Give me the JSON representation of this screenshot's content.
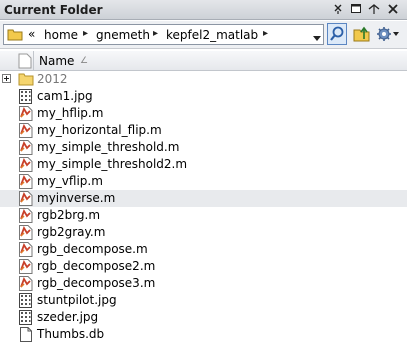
{
  "panel": {
    "title": "Current Folder"
  },
  "titlebar_buttons": [
    {
      "name": "pin-icon"
    },
    {
      "name": "undock-icon"
    },
    {
      "name": "maximize-icon"
    },
    {
      "name": "close-icon"
    }
  ],
  "address": {
    "overflow": "«",
    "crumbs": [
      "home",
      "gnemeth",
      "kepfel2_matlab"
    ],
    "separator": "▸"
  },
  "columns": {
    "name": "Name",
    "sort_indicator": "∠"
  },
  "files": [
    {
      "name": "2012",
      "type": "folder"
    },
    {
      "name": "cam1.jpg",
      "type": "image"
    },
    {
      "name": "my_hflip.m",
      "type": "mfile"
    },
    {
      "name": "my_horizontal_flip.m",
      "type": "mfile"
    },
    {
      "name": "my_simple_threshold.m",
      "type": "mfile"
    },
    {
      "name": "my_simple_threshold2.m",
      "type": "mfile"
    },
    {
      "name": "my_vflip.m",
      "type": "mfile"
    },
    {
      "name": "myinverse.m",
      "type": "mfile"
    },
    {
      "name": "rgb2brg.m",
      "type": "mfile"
    },
    {
      "name": "rgb2gray.m",
      "type": "mfile"
    },
    {
      "name": "rgb_decompose.m",
      "type": "mfile"
    },
    {
      "name": "rgb_decompose2.m",
      "type": "mfile"
    },
    {
      "name": "rgb_decompose3.m",
      "type": "mfile"
    },
    {
      "name": "stuntpilot.jpg",
      "type": "image"
    },
    {
      "name": "szeder.jpg",
      "type": "image"
    },
    {
      "name": "Thumbs.db",
      "type": "doc"
    }
  ],
  "selected_file": "myinverse.m",
  "colors": {
    "accent": "#5b86c2",
    "folder": "#f2c94c",
    "mfile": "#c8402a"
  }
}
